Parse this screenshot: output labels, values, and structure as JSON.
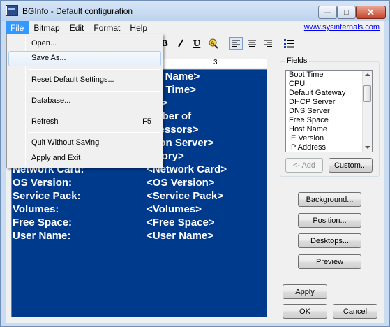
{
  "window": {
    "title": "BGInfo - Default configuration",
    "minimize_glyph": "—",
    "maximize_glyph": "□",
    "close_glyph": "✕"
  },
  "menubar": {
    "items": [
      "File",
      "Bitmap",
      "Edit",
      "Format",
      "Help"
    ],
    "link": "www.sysinternals.com"
  },
  "toolbar": {
    "bold": "B",
    "italic": "I",
    "underline": "U",
    "ruler_mark": "3"
  },
  "file_menu": {
    "items": [
      {
        "label": "Open..."
      },
      {
        "label": "Save As..."
      },
      {
        "label": "Reset Default Settings..."
      },
      {
        "label": "Database..."
      },
      {
        "label": "Refresh",
        "shortcut": "F5"
      },
      {
        "label": "Quit Without Saving"
      },
      {
        "label": "Apply and Exit"
      }
    ]
  },
  "editor": {
    "rows": [
      {
        "label": "",
        "value": "ost Name>"
      },
      {
        "label": "",
        "value": "oot Time>"
      },
      {
        "label": "",
        "value": "PU>"
      },
      {
        "label": "",
        "value": "umber of"
      },
      {
        "label": "",
        "value": "ocessors>"
      },
      {
        "label": "",
        "value": "ogon Server>"
      },
      {
        "label": "",
        "value": "emory>"
      },
      {
        "label": "Network Card:",
        "value": "<Network Card>"
      },
      {
        "label": "OS Version:",
        "value": "<OS Version>"
      },
      {
        "label": "Service Pack:",
        "value": "<Service Pack>"
      },
      {
        "label": "Volumes:",
        "value": "<Volumes>"
      },
      {
        "label": "Free Space:",
        "value": "<Free Space>"
      },
      {
        "label": "User Name:",
        "value": "<User Name>"
      }
    ],
    "background": "#003a8c"
  },
  "fields": {
    "legend": "Fields",
    "items": [
      "Boot Time",
      "CPU",
      "Default Gateway",
      "DHCP Server",
      "DNS Server",
      "Free Space",
      "Host Name",
      "IE Version",
      "IP Address"
    ],
    "add_button": "<- Add",
    "custom_button": "Custom..."
  },
  "buttons": {
    "background": "Background...",
    "position": "Position...",
    "desktops": "Desktops...",
    "preview": "Preview",
    "apply": "Apply",
    "ok": "OK",
    "cancel": "Cancel"
  }
}
